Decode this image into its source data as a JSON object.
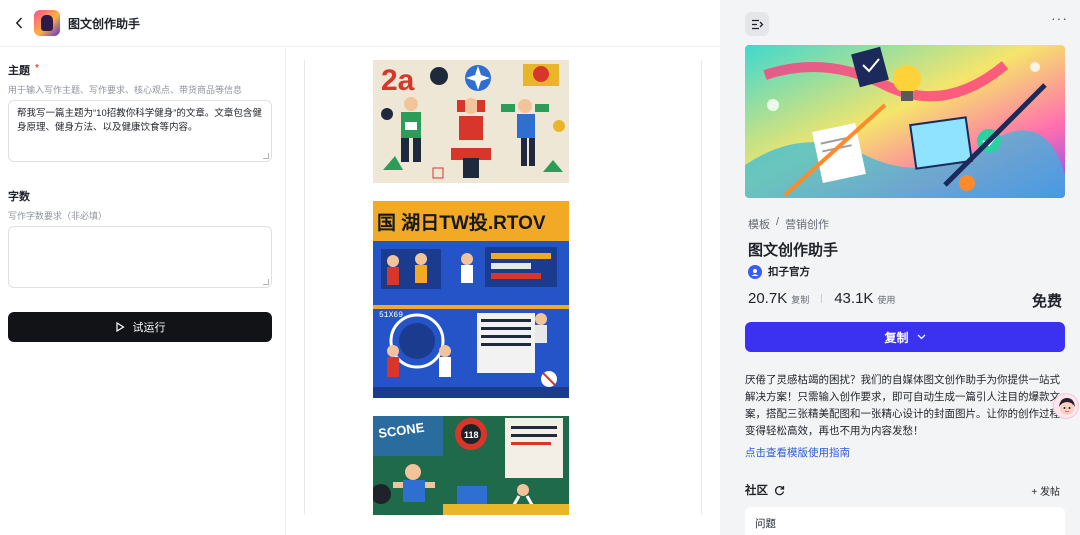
{
  "header": {
    "title": "图文创作助手"
  },
  "form": {
    "topic_label": "主题",
    "topic_required": "*",
    "topic_hint": "用于输入写作主题、写作要求、核心观点、带货商品等信息",
    "topic_value": "帮我写一篇主题为“10招教你科学健身”的文章。文章包含健身原理、健身方法、以及健康饮食等内容。",
    "words_label": "字数",
    "words_hint": "写作字数要求（非必填）",
    "words_value": "",
    "run_button": "试运行"
  },
  "preview": {
    "posters": [
      "poster-athletes",
      "poster-sports-infographic",
      "poster-fitness-timer"
    ],
    "poster2_headline": "国 湖日TW投.RTOV",
    "poster3_headline": "SCONE"
  },
  "panel": {
    "more_label": "···",
    "breadcrumb": [
      "模板",
      "/",
      "营销创作"
    ],
    "title": "图文创作助手",
    "author": "扣子官方",
    "copies": "20.7K",
    "copies_unit": "复制",
    "uses": "43.1K",
    "uses_unit": "使用",
    "price": "免费",
    "copy_button": "复制",
    "description": "厌倦了灵感枯竭的困扰？我们的自媒体图文创作助手为你提供一站式解决方案！只需输入创作要求，即可自动生成一篇引人注目的爆款文案，搭配三张精美配图和一张精心设计的封面图片。让你的创作过程变得轻松高效，再也不用为内容发愁！",
    "guide_link": "点击查看模版使用指南",
    "community_label": "社区",
    "post_button": "+ 发帖",
    "question_label": "问题"
  },
  "colors": {
    "primary": "#3a32f0",
    "run_button_bg": "#111317",
    "link": "#2b5bd7",
    "required": "#f54a45"
  }
}
